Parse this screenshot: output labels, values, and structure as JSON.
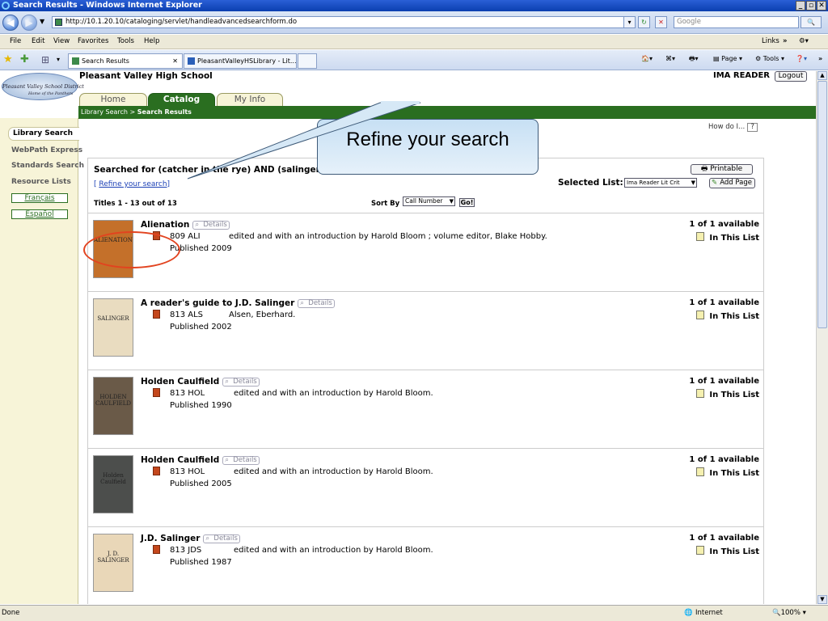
{
  "window": {
    "title": "Search Results - Windows Internet Explorer"
  },
  "address": {
    "url": "http://10.1.20.10/cataloging/servlet/handleadvancedsearchform.do",
    "search_placeholder": "Google"
  },
  "menu": [
    "File",
    "Edit",
    "View",
    "Favorites",
    "Tools",
    "Help"
  ],
  "menu_right": {
    "links": "Links"
  },
  "tabs": [
    {
      "label": "Search Results"
    },
    {
      "label": "PleasantValleyHSLibrary - Lit..."
    }
  ],
  "commands": {
    "page": "Page",
    "tools": "Tools"
  },
  "page": {
    "school_name": "Pleasant Valley High School",
    "logo_text": "Pleasant Valley School District",
    "logo_sub": "Home of the Panthers",
    "user_name": "IMA READER",
    "logout": "Logout",
    "nav_tabs": [
      "Home",
      "Catalog",
      "My Info"
    ],
    "breadcrumb": {
      "parent": "Library Search",
      "sep": " > ",
      "current": "Search Results"
    },
    "sidebar": [
      "Library Search",
      "WebPath Express",
      "Standards Search",
      "Resource Lists"
    ],
    "languages": [
      "Français",
      "Español"
    ],
    "how_do_i": "How do I...",
    "how_q": "?",
    "searched_for": "Searched for (catcher in the rye) AND (salinger) AND (crit*) in Pleasant Valley High School",
    "refine_link": "Refine your search",
    "printable": "Printable",
    "selected_list_label": "Selected List:",
    "selected_list_value": "Ima Reader Lit Crit",
    "add_page": "Add Page",
    "titles_count": "Titles 1 - 13 out of 13",
    "sort_by_label": "Sort By",
    "sort_by_value": "Call Number",
    "go": "Go!",
    "details_label": "Details",
    "results": [
      {
        "title": "Alienation",
        "call_number": "809 ALI",
        "author": "edited and with an introduction by Harold Bloom ; volume editor, Blake Hobby.",
        "published": "Published 2009",
        "availability": "1 of 1 available",
        "list_status": "In This List",
        "cover_color": "#c4702a",
        "cover_text": "ALIENATION"
      },
      {
        "title": "A reader's guide to J.D. Salinger",
        "call_number": "813 ALS",
        "author": "Alsen, Eberhard.",
        "published": "Published 2002",
        "availability": "1 of 1 available",
        "list_status": "In This List",
        "cover_color": "#e9dcc0",
        "cover_text": "SALINGER"
      },
      {
        "title": "Holden Caulfield",
        "call_number": "813 HOL",
        "author": "edited and with an introduction by Harold Bloom.",
        "published": "Published 1990",
        "availability": "1 of 1 available",
        "list_status": "In This List",
        "cover_color": "#6a5a48",
        "cover_text": "HOLDEN CAULFIELD"
      },
      {
        "title": "Holden Caulfield",
        "call_number": "813 HOL",
        "author": "edited and with an introduction by Harold Bloom.",
        "published": "Published 2005",
        "availability": "1 of 1 available",
        "list_status": "In This List",
        "cover_color": "#4c4e4c",
        "cover_text": "Holden Caulfield"
      },
      {
        "title": "J.D. Salinger",
        "call_number": "813 JDS",
        "author": "edited and with an introduction by Harold Bloom.",
        "published": "Published 1987",
        "availability": "1 of 1 available",
        "list_status": "In This List",
        "cover_color": "#e9d7b8",
        "cover_text": "J. D. SALINGER"
      }
    ]
  },
  "callout": {
    "text": "Refine your search",
    "color": "#e2431f"
  },
  "status": {
    "left": "Done",
    "zone": "Internet",
    "zoom": "100%"
  }
}
